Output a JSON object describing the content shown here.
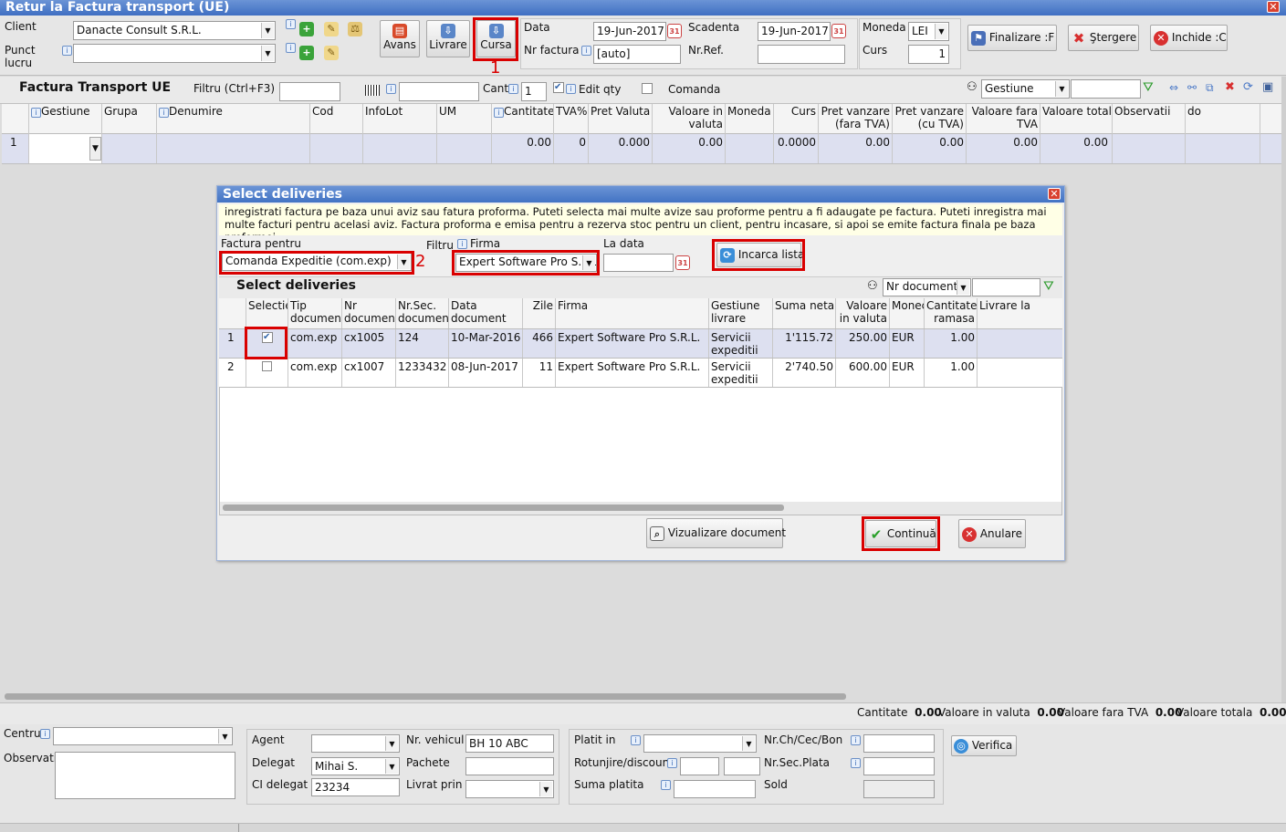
{
  "window": {
    "title": "Retur la Factura transport (UE)"
  },
  "header": {
    "client_label": "Client",
    "client_value": "Danacte Consult S.R.L.",
    "punct_label_1": "Punct",
    "punct_label_2": "lucru",
    "punct_value": "",
    "avans_label": "Avans",
    "livrare_label": "Livrare",
    "cursa_label": "Cursa",
    "annot_1": "1",
    "data_label": "Data",
    "data_value": "19-Jun-2017",
    "scadenta_label": "Scadenta",
    "scadenta_value": "19-Jun-2017",
    "nrfactura_label": "Nr factura",
    "nrfactura_value": "[auto]",
    "nrref_label": "Nr.Ref.",
    "nrref_value": "",
    "moneda_label": "Moneda",
    "moneda_value": "LEI",
    "curs_label": "Curs",
    "curs_value": "1",
    "finalizare_label": "Finalizare :F",
    "stergere_label": "Ştergere",
    "inchide_label": "Inchide :C"
  },
  "toolbar": {
    "section_title": "Factura Transport UE",
    "filtru_label": "Filtru (Ctrl+F3)",
    "filtru_value": "",
    "barcode_value": "",
    "cant_label": "Cant",
    "cant_value": "1",
    "editqty_label": "Edit qty",
    "comanda_label": "Comanda",
    "gestiune_value": "Gestiune",
    "gestiune_search": ""
  },
  "main_grid": {
    "headers": [
      "Gestiune",
      "Grupa",
      "Denumire",
      "Cod",
      "InfoLot",
      "UM",
      "Cantitate",
      "TVA%",
      "Pret Valuta",
      "Valoare in valuta",
      "Moneda",
      "Curs",
      "Pret vanzare (fara TVA)",
      "Pret vanzare (cu TVA)",
      "Valoare fara TVA",
      "Valoare totala",
      "Observatii",
      "do"
    ],
    "row": {
      "nr": "1",
      "cantitate": "0.00",
      "tva": "0",
      "pret_valuta": "0.000",
      "valoare_valuta": "0.00",
      "curs": "0.0000",
      "pv_fara": "0.00",
      "pv_cu": "0.00",
      "val_fara": "0.00",
      "val_totala": "0.00"
    }
  },
  "dialog": {
    "title": "Select deliveries",
    "info": "inregistrati factura pe baza unui aviz sau fatura proforma. Puteti selecta mai multe avize sau proforme pentru a fi adaugate pe factura. Puteti inregistra mai multe facturi pentru acelasi aviz. Factura proforma e emisa pentru a rezerva stoc pentru un client, pentru incasare, si apoi se emite factura finala pe baza proformei.",
    "factura_pentru_label": "Factura pentru",
    "factura_pentru_value": "Comanda Expeditie (com.exp)",
    "annot_2": "2",
    "filtru_label": "Filtru",
    "firma_label": "Firma",
    "firma_value": "Expert Software Pro S.R.L.",
    "ladata_label": "La data",
    "ladata_value": "",
    "incarca_label": "Incarca lista",
    "grid_title": "Select deliveries",
    "sort_value": "Nr document",
    "search_value": "",
    "headers": [
      {
        "l1": "Selectie",
        "l2": ""
      },
      {
        "l1": "Tip",
        "l2": "document"
      },
      {
        "l1": "Nr",
        "l2": "document"
      },
      {
        "l1": "Nr.Sec.",
        "l2": "document"
      },
      {
        "l1": "Data",
        "l2": "document"
      },
      {
        "l1": "Zile",
        "l2": ""
      },
      {
        "l1": "Firma",
        "l2": ""
      },
      {
        "l1": "Gestiune",
        "l2": "livrare"
      },
      {
        "l1": "Suma neta",
        "l2": ""
      },
      {
        "l1": "Valoare",
        "l2": "in valuta"
      },
      {
        "l1": "Monec",
        "l2": ""
      },
      {
        "l1": "Cantitate",
        "l2": "ramasa"
      },
      {
        "l1": "Livrare la",
        "l2": ""
      }
    ],
    "rows": [
      {
        "nr": "1",
        "checked": true,
        "tip": "com.exp",
        "nrdoc": "cx1005",
        "nrsec": "124",
        "data": "10-Mar-2016",
        "zile": "466",
        "firma": "Expert Software Pro S.R.L.",
        "gest1": "Servicii",
        "gest2": "expeditii",
        "suma": "1'115.72",
        "valoare": "250.00",
        "moneda": "EUR",
        "cant": "1.00",
        "livrare": ""
      },
      {
        "nr": "2",
        "checked": false,
        "tip": "com.exp",
        "nrdoc": "cx1007",
        "nrsec": "1233432",
        "data": "08-Jun-2017",
        "zile": "11",
        "firma": "Expert Software Pro S.R.L.",
        "gest1": "Servicii",
        "gest2": "expeditii",
        "suma": "2'740.50",
        "valoare": "600.00",
        "moneda": "EUR",
        "cant": "1.00",
        "livrare": ""
      }
    ],
    "viz_label": "Vizualizare document",
    "continua_label": "Continuă",
    "anulare_label": "Anulare"
  },
  "totals": {
    "cant_label": "Cantitate",
    "cant_value": "0.00",
    "val_valuta_label": "Valoare in valuta",
    "val_valuta_value": "0.00",
    "val_fara_label": "Valoare fara TVA",
    "val_fara_value": "0.00",
    "val_tot_label": "Valoare totala",
    "val_tot_value": "0.00"
  },
  "footer": {
    "centru_label": "Centru",
    "centru_value": "",
    "obs_label": "Observatii",
    "obs_value": "",
    "agent_label": "Agent",
    "agent_value": "",
    "delegat_label": "Delegat",
    "delegat_value": "Mihai S.",
    "ci_label": "CI delegat",
    "ci_value": "23234",
    "nrveh_label": "Nr. vehicul",
    "nrveh_value": "BH 10 ABC",
    "pachete_label": "Pachete",
    "pachete_value": "",
    "livratprin_label": "Livrat prin",
    "livratprin_value": "",
    "platit_label": "Platit in",
    "platit_value": "",
    "rotunjire_label": "Rotunjire/discount",
    "suma_label": "Suma platita",
    "suma_value": "",
    "nrch_label": "Nr.Ch/Cec/Bon",
    "nrch_value": "",
    "nrsec_label": "Nr.Sec.Plata",
    "nrsec_value": "",
    "sold_label": "Sold",
    "sold_value": "",
    "verifica_label": "Verifica"
  },
  "colors": {
    "accent": "#d90000",
    "title_bar": "#4a78c6",
    "row_highlight": "#dde0f0",
    "info_bg": "#ffffe6"
  }
}
